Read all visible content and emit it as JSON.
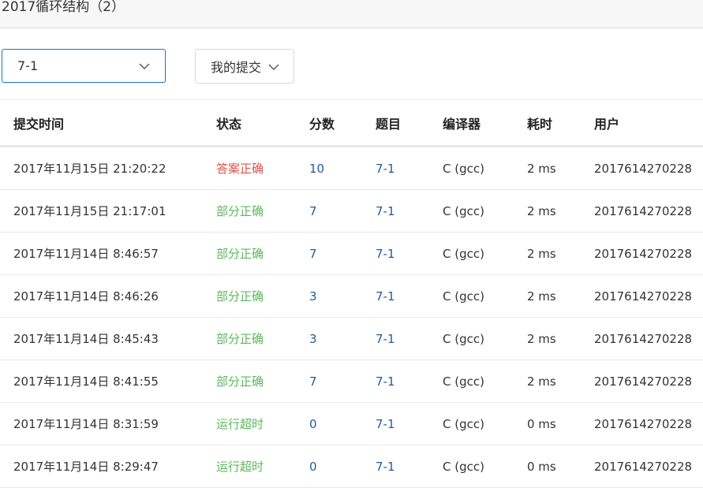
{
  "header": {
    "title": "2017循环结构（2）"
  },
  "filters": {
    "problem_select_value": "7-1",
    "my_submissions_label": "我的提交"
  },
  "table": {
    "columns": [
      "提交时间",
      "状态",
      "分数",
      "题目",
      "编译器",
      "耗时",
      "用户"
    ],
    "rows": [
      {
        "time": "2017年11月15日 21:20:22",
        "status": "答案正确",
        "status_kind": "accept",
        "score": "10",
        "problem": "7-1",
        "compiler": "C (gcc)",
        "cost": "2 ms",
        "user": "2017614270228"
      },
      {
        "time": "2017年11月15日 21:17:01",
        "status": "部分正确",
        "status_kind": "partial",
        "score": "7",
        "problem": "7-1",
        "compiler": "C (gcc)",
        "cost": "2 ms",
        "user": "2017614270228"
      },
      {
        "time": "2017年11月14日 8:46:57",
        "status": "部分正确",
        "status_kind": "partial",
        "score": "7",
        "problem": "7-1",
        "compiler": "C (gcc)",
        "cost": "2 ms",
        "user": "2017614270228"
      },
      {
        "time": "2017年11月14日 8:46:26",
        "status": "部分正确",
        "status_kind": "partial",
        "score": "3",
        "problem": "7-1",
        "compiler": "C (gcc)",
        "cost": "2 ms",
        "user": "2017614270228"
      },
      {
        "time": "2017年11月14日 8:45:43",
        "status": "部分正确",
        "status_kind": "partial",
        "score": "3",
        "problem": "7-1",
        "compiler": "C (gcc)",
        "cost": "2 ms",
        "user": "2017614270228"
      },
      {
        "time": "2017年11月14日 8:41:55",
        "status": "部分正确",
        "status_kind": "partial",
        "score": "7",
        "problem": "7-1",
        "compiler": "C (gcc)",
        "cost": "2 ms",
        "user": "2017614270228"
      },
      {
        "time": "2017年11月14日 8:31:59",
        "status": "运行超时",
        "status_kind": "timeout",
        "score": "0",
        "problem": "7-1",
        "compiler": "C (gcc)",
        "cost": "0 ms",
        "user": "2017614270228"
      },
      {
        "time": "2017年11月14日 8:29:47",
        "status": "运行超时",
        "status_kind": "timeout",
        "score": "0",
        "problem": "7-1",
        "compiler": "C (gcc)",
        "cost": "0 ms",
        "user": "2017614270228"
      }
    ]
  },
  "icons": {
    "dropdown": "chevron-down-icon"
  },
  "colors": {
    "accept": "#d9534f",
    "partial": "#5cb85c",
    "link": "#1f5c99",
    "select_border": "#1a74c5"
  }
}
